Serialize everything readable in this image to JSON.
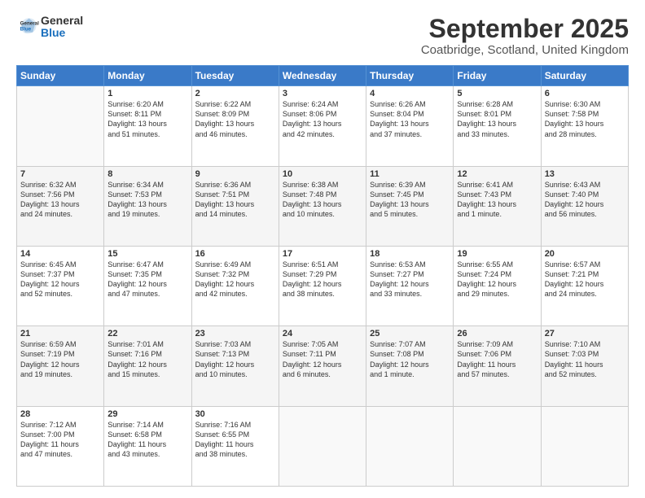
{
  "header": {
    "logo_general": "General",
    "logo_blue": "Blue",
    "month_title": "September 2025",
    "location": "Coatbridge, Scotland, United Kingdom"
  },
  "days_of_week": [
    "Sunday",
    "Monday",
    "Tuesday",
    "Wednesday",
    "Thursday",
    "Friday",
    "Saturday"
  ],
  "weeks": [
    [
      {
        "day": "",
        "info": ""
      },
      {
        "day": "1",
        "info": "Sunrise: 6:20 AM\nSunset: 8:11 PM\nDaylight: 13 hours\nand 51 minutes."
      },
      {
        "day": "2",
        "info": "Sunrise: 6:22 AM\nSunset: 8:09 PM\nDaylight: 13 hours\nand 46 minutes."
      },
      {
        "day": "3",
        "info": "Sunrise: 6:24 AM\nSunset: 8:06 PM\nDaylight: 13 hours\nand 42 minutes."
      },
      {
        "day": "4",
        "info": "Sunrise: 6:26 AM\nSunset: 8:04 PM\nDaylight: 13 hours\nand 37 minutes."
      },
      {
        "day": "5",
        "info": "Sunrise: 6:28 AM\nSunset: 8:01 PM\nDaylight: 13 hours\nand 33 minutes."
      },
      {
        "day": "6",
        "info": "Sunrise: 6:30 AM\nSunset: 7:58 PM\nDaylight: 13 hours\nand 28 minutes."
      }
    ],
    [
      {
        "day": "7",
        "info": "Sunrise: 6:32 AM\nSunset: 7:56 PM\nDaylight: 13 hours\nand 24 minutes."
      },
      {
        "day": "8",
        "info": "Sunrise: 6:34 AM\nSunset: 7:53 PM\nDaylight: 13 hours\nand 19 minutes."
      },
      {
        "day": "9",
        "info": "Sunrise: 6:36 AM\nSunset: 7:51 PM\nDaylight: 13 hours\nand 14 minutes."
      },
      {
        "day": "10",
        "info": "Sunrise: 6:38 AM\nSunset: 7:48 PM\nDaylight: 13 hours\nand 10 minutes."
      },
      {
        "day": "11",
        "info": "Sunrise: 6:39 AM\nSunset: 7:45 PM\nDaylight: 13 hours\nand 5 minutes."
      },
      {
        "day": "12",
        "info": "Sunrise: 6:41 AM\nSunset: 7:43 PM\nDaylight: 13 hours\nand 1 minute."
      },
      {
        "day": "13",
        "info": "Sunrise: 6:43 AM\nSunset: 7:40 PM\nDaylight: 12 hours\nand 56 minutes."
      }
    ],
    [
      {
        "day": "14",
        "info": "Sunrise: 6:45 AM\nSunset: 7:37 PM\nDaylight: 12 hours\nand 52 minutes."
      },
      {
        "day": "15",
        "info": "Sunrise: 6:47 AM\nSunset: 7:35 PM\nDaylight: 12 hours\nand 47 minutes."
      },
      {
        "day": "16",
        "info": "Sunrise: 6:49 AM\nSunset: 7:32 PM\nDaylight: 12 hours\nand 42 minutes."
      },
      {
        "day": "17",
        "info": "Sunrise: 6:51 AM\nSunset: 7:29 PM\nDaylight: 12 hours\nand 38 minutes."
      },
      {
        "day": "18",
        "info": "Sunrise: 6:53 AM\nSunset: 7:27 PM\nDaylight: 12 hours\nand 33 minutes."
      },
      {
        "day": "19",
        "info": "Sunrise: 6:55 AM\nSunset: 7:24 PM\nDaylight: 12 hours\nand 29 minutes."
      },
      {
        "day": "20",
        "info": "Sunrise: 6:57 AM\nSunset: 7:21 PM\nDaylight: 12 hours\nand 24 minutes."
      }
    ],
    [
      {
        "day": "21",
        "info": "Sunrise: 6:59 AM\nSunset: 7:19 PM\nDaylight: 12 hours\nand 19 minutes."
      },
      {
        "day": "22",
        "info": "Sunrise: 7:01 AM\nSunset: 7:16 PM\nDaylight: 12 hours\nand 15 minutes."
      },
      {
        "day": "23",
        "info": "Sunrise: 7:03 AM\nSunset: 7:13 PM\nDaylight: 12 hours\nand 10 minutes."
      },
      {
        "day": "24",
        "info": "Sunrise: 7:05 AM\nSunset: 7:11 PM\nDaylight: 12 hours\nand 6 minutes."
      },
      {
        "day": "25",
        "info": "Sunrise: 7:07 AM\nSunset: 7:08 PM\nDaylight: 12 hours\nand 1 minute."
      },
      {
        "day": "26",
        "info": "Sunrise: 7:09 AM\nSunset: 7:06 PM\nDaylight: 11 hours\nand 57 minutes."
      },
      {
        "day": "27",
        "info": "Sunrise: 7:10 AM\nSunset: 7:03 PM\nDaylight: 11 hours\nand 52 minutes."
      }
    ],
    [
      {
        "day": "28",
        "info": "Sunrise: 7:12 AM\nSunset: 7:00 PM\nDaylight: 11 hours\nand 47 minutes."
      },
      {
        "day": "29",
        "info": "Sunrise: 7:14 AM\nSunset: 6:58 PM\nDaylight: 11 hours\nand 43 minutes."
      },
      {
        "day": "30",
        "info": "Sunrise: 7:16 AM\nSunset: 6:55 PM\nDaylight: 11 hours\nand 38 minutes."
      },
      {
        "day": "",
        "info": ""
      },
      {
        "day": "",
        "info": ""
      },
      {
        "day": "",
        "info": ""
      },
      {
        "day": "",
        "info": ""
      }
    ]
  ]
}
